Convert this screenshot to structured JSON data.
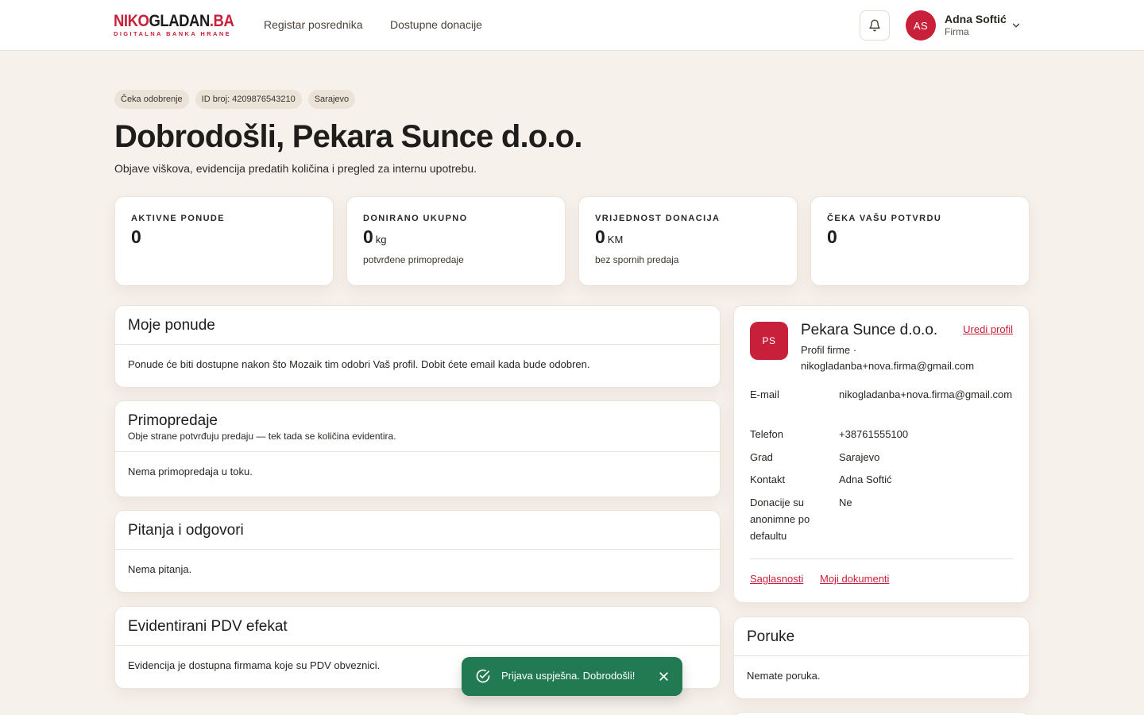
{
  "header": {
    "logo_main_red": "NIKO",
    "logo_main_dark": "GLADAN",
    "logo_main_red2": ".BA",
    "logo_sub": "DIGITALNA BANKA HRANE",
    "nav": [
      "Registar posrednika",
      "Dostupne donacije"
    ],
    "avatar_initials": "AS",
    "user_name": "Adna Softić",
    "user_role": "Firma"
  },
  "tags": [
    "Čeka odobrenje",
    "ID broj: 4209876543210",
    "Sarajevo"
  ],
  "page": {
    "title": "Dobrodošli, Pekara Sunce d.o.o.",
    "subtitle": "Objave viškova, evidencija predatih količina i pregled za internu upotrebu."
  },
  "stats": [
    {
      "label": "AKTIVNE PONUDE",
      "value": "0",
      "unit": "",
      "note": ""
    },
    {
      "label": "DONIRANO UKUPNO",
      "value": "0",
      "unit": "kg",
      "note": "potvrđene primopredaje"
    },
    {
      "label": "VRIJEDNOST DONACIJA",
      "value": "0",
      "unit": "KM",
      "note": "bez spornih predaja"
    },
    {
      "label": "ČEKA VAŠU POTVRDU",
      "value": "0",
      "unit": "",
      "note": ""
    }
  ],
  "panels": {
    "offers": {
      "title": "Moje ponude",
      "body": "Ponude će biti dostupne nakon što Mozaik tim odobri Vaš profil. Dobit ćete email kada bude odobren."
    },
    "handovers": {
      "title": "Primopredaje",
      "desc": "Obje strane potvrđuju predaju — tek tada se količina evidentira.",
      "body": "Nema primopredaja u toku."
    },
    "qa": {
      "title": "Pitanja i odgovori",
      "body": "Nema pitanja."
    },
    "vat": {
      "title": "Evidentirani PDV efekat",
      "body": "Evidencija je dostupna firmama koje su PDV obveznici."
    },
    "messages": {
      "title": "Poruke",
      "body": "Nemate poruka."
    }
  },
  "profile": {
    "initials": "PS",
    "name": "Pekara Sunce d.o.o.",
    "edit_label": "Uredi profil",
    "meta": "Profil firme · nikogladanba+nova.firma@gmail.com",
    "rows": [
      {
        "label": "E-mail",
        "value": "nikogladanba+nova.firma@gmail.com"
      },
      {
        "label": "Telefon",
        "value": "+38761555100"
      },
      {
        "label": "Grad",
        "value": "Sarajevo"
      },
      {
        "label": "Kontakt",
        "value": "Adna Softić"
      },
      {
        "label": "Donacije su anonimne po defaultu",
        "value": "Ne"
      }
    ],
    "links": [
      "Saglasnosti",
      "Moji dokumenti"
    ]
  },
  "toast": {
    "text": "Prijava uspješna. Dobrodošli!"
  },
  "colors": {
    "brand": "#c8203b",
    "success": "#217a52",
    "background": "#f6f1eb"
  }
}
